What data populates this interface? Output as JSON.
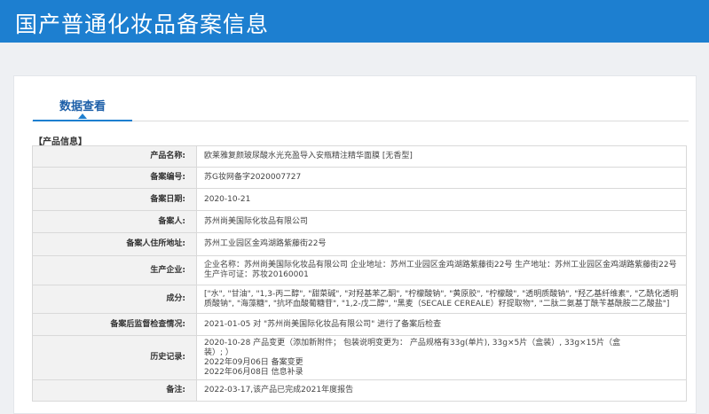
{
  "header": {
    "title": "国产普通化妆品备案信息"
  },
  "tabs": [
    {
      "label": "数据查看"
    }
  ],
  "section": {
    "title": "【产品信息】"
  },
  "rows": [
    {
      "label": "产品名称:",
      "value": "欧莱雅复颜玻尿酸水光充盈导入安瓶精注精华面膜 [无香型]"
    },
    {
      "label": "备案编号:",
      "value": "苏G妆网备字2020007727"
    },
    {
      "label": "备案日期:",
      "value": "2020-10-21"
    },
    {
      "label": "备案人:",
      "value": "苏州尚美国际化妆品有限公司"
    },
    {
      "label": "备案人住所地址:",
      "value": "苏州工业园区金鸡湖路紫藤街22号"
    },
    {
      "label": "生产企业:",
      "value": "企业名称：苏州尚美国际化妆品有限公司 企业地址：苏州工业园区金鸡湖路紫藤街22号 生产地址：苏州工业园区金鸡湖路紫藤街22号 生产许可证：苏妆20160001"
    },
    {
      "label": "成分:",
      "value": "[\"水\", \"甘油\", \"1,3-丙二醇\", \"甜菜碱\", \"对羟基苯乙酮\", \"柠檬酸钠\", \"黄原胶\", \"柠檬酸\", \"透明质酸钠\", \"羟乙基纤维素\", \"乙酰化透明质酸钠\", \"海藻糖\", \"抗坏血酸葡糖苷\", \"1,2-戊二醇\", \"黑麦（SECALE CEREALE）籽提取物\", \"二肽二氨基丁酰苄基酰胺二乙酸盐\"]"
    },
    {
      "label": "备案后监督检查情况:",
      "value": "2021-01-05 对 \"苏州尚美国际化妆品有限公司\" 进行了备案后检查"
    },
    {
      "label": "历史记录:",
      "lines": [
        "2020-10-28 产品变更（添加新附件； 包装说明变更为： 产品规格有33g(单片), 33g×5片（盒装）, 33g×15片（盒",
        "装）; ）",
        "2022年09月06日 备案变更",
        "2022年06月08日 信息补录"
      ]
    },
    {
      "label": "备注:",
      "value": "2022-03-17,该产品已完成2021年度报告"
    }
  ]
}
